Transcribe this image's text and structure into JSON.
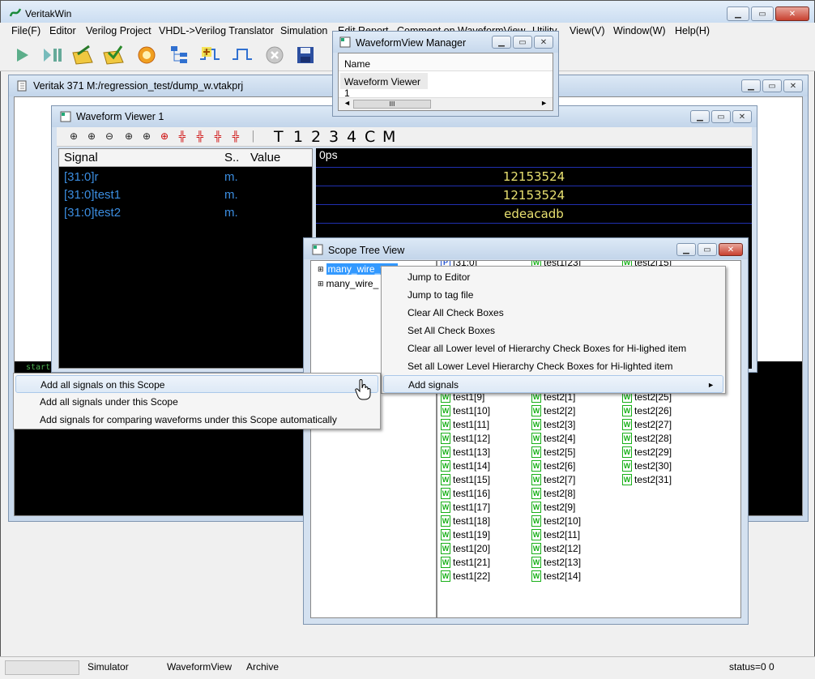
{
  "app": {
    "title": "VeritakWin"
  },
  "menubar": [
    "File(F)",
    "Editor",
    "Verilog Project",
    "VHDL->Verilog Translator",
    "Simulation",
    "Edit Report",
    "Comment on WaveformView",
    "Utility",
    "View(V)",
    "Window(W)",
    "Help(H)"
  ],
  "project_window": {
    "title": "Veritak 371 M:/regression_test/dump_w.vtakprj",
    "console_text": "starts"
  },
  "waveform_manager": {
    "title": "WaveformView Manager",
    "column_name": "Name",
    "rows": [
      "Waveform Viewer 1"
    ],
    "scroll_glyph": "III"
  },
  "waveform_viewer": {
    "title": "Waveform Viewer 1",
    "toolbar_text": [
      "T",
      "1",
      "2",
      "3",
      "4",
      "C",
      "M"
    ],
    "columns": {
      "signal": "Signal",
      "s": "S..",
      "value": "Value"
    },
    "time_label": "0ps",
    "signals": [
      {
        "name": "[31:0]r",
        "s": "m.",
        "wave_value": "12153524"
      },
      {
        "name": "[31:0]test1",
        "s": "m.",
        "wave_value": "12153524"
      },
      {
        "name": "[31:0]test2",
        "s": "m.",
        "wave_value": "edeacadb"
      }
    ]
  },
  "scope_tree": {
    "title": "Scope Tree View",
    "tree_items": [
      "many_wire_test",
      "many_wire_"
    ],
    "col_partial_top": [
      "[31:0]",
      "test1[23]",
      "test2[15]"
    ],
    "col1": [
      "test1[9]",
      "test1[10]",
      "test1[11]",
      "test1[12]",
      "test1[13]",
      "test1[14]",
      "test1[15]",
      "test1[16]",
      "test1[17]",
      "test1[18]",
      "test1[19]",
      "test1[20]",
      "test1[21]",
      "test1[22]"
    ],
    "col2": [
      "test2[1]",
      "test2[2]",
      "test2[3]",
      "test2[4]",
      "test2[5]",
      "test2[6]",
      "test2[7]",
      "test2[8]",
      "test2[9]",
      "test2[10]",
      "test2[11]",
      "test2[12]",
      "test2[13]",
      "test2[14]"
    ],
    "col3": [
      "test2[25]",
      "test2[26]",
      "test2[27]",
      "test2[28]",
      "test2[29]",
      "test2[30]",
      "test2[31]"
    ]
  },
  "context_menu": {
    "items": [
      "Jump to Editor",
      "Jump to tag file",
      "Clear All Check Boxes",
      "Set All Check Boxes",
      "Clear all Lower level of Hierarchy Check Boxes for Hi-lighed item",
      "Set all Lower Level Hierarchy Check Boxes for Hi-lighted item",
      "Add signals"
    ],
    "submenu_arrow": "►"
  },
  "submenu": {
    "items": [
      "Add all signals on this Scope",
      "Add all signals under this Scope",
      "Add signals for comparing waveforms under this Scope automatically"
    ]
  },
  "statusbar": {
    "tabs": [
      "Simulator",
      "WaveformView",
      "Archive"
    ],
    "status": "status=0 0"
  },
  "colors": {
    "accent": "#3b8de0",
    "wave_value": "#e8e070",
    "wire_green": "#18b018"
  }
}
